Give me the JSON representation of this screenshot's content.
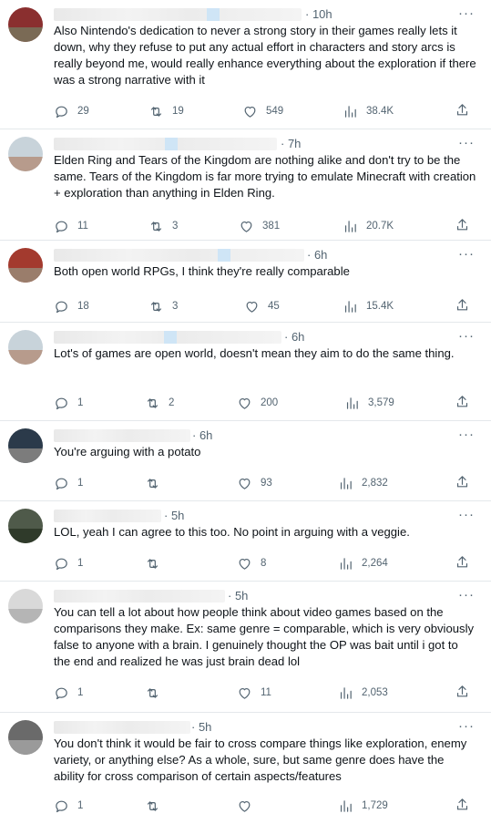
{
  "more_label": "···",
  "tweets": [
    {
      "time": "· 10h",
      "text": "Also Nintendo's dedication to never a strong story in their games really lets it down, why they refuse to put any actual effort in characters and story arcs is really beyond me, would really enhance everything about the exploration if there was a strong narrative with it",
      "replies": "29",
      "reposts": "19",
      "likes": "549",
      "views": "38.4K",
      "avatar_colors": [
        "#8a2f2f",
        "#7a6a55"
      ]
    },
    {
      "time": "· 7h",
      "text": "Elden Ring and Tears of the Kingdom are nothing alike and don't try to be the same. Tears of the Kingdom is far more trying to emulate Minecraft with creation + exploration than anything in Elden Ring.",
      "replies": "11",
      "reposts": "3",
      "likes": "381",
      "views": "20.7K",
      "avatar_colors": [
        "#c8d3da",
        "#b79b8c"
      ]
    },
    {
      "time": "· 6h",
      "text": "Both open world RPGs, I think they're really comparable",
      "replies": "18",
      "reposts": "3",
      "likes": "45",
      "views": "15.4K",
      "avatar_colors": [
        "#a33a2e",
        "#9a7d6b"
      ]
    },
    {
      "time": "· 6h",
      "text": "Lot's of games are open world, doesn't mean they aim to do the same thing.",
      "replies": "1",
      "reposts": "2",
      "likes": "200",
      "views": "3,579",
      "avatar_colors": [
        "#c8d3da",
        "#b79b8c"
      ]
    },
    {
      "time": "· 6h",
      "text": "You're arguing with a potato",
      "replies": "1",
      "reposts": "",
      "likes": "93",
      "views": "2,832",
      "avatar_colors": [
        "#2b3a4a",
        "#7c7c7c"
      ]
    },
    {
      "time": "· 5h",
      "text": "LOL, yeah I can agree to this too. No point in arguing with a veggie.",
      "replies": "1",
      "reposts": "",
      "likes": "8",
      "views": "2,264",
      "avatar_colors": [
        "#4f5a4a",
        "#2f3a2a"
      ]
    },
    {
      "time": "· 5h",
      "text": "You can tell a lot about how people think about video games based on the comparisons they make. Ex: same genre = comparable, which is very obviously false to anyone with a brain. I genuinely thought the OP was bait until i got to the end and realized he was just brain dead lol",
      "replies": "1",
      "reposts": "",
      "likes": "11",
      "views": "2,053",
      "avatar_colors": [
        "#d9d9d9",
        "#b5b5b5"
      ]
    },
    {
      "time": "· 5h",
      "text": "You don't think it would be fair to cross compare things like exploration, enemy variety, or anything else? As a whole, sure, but same genre does have the ability for cross comparison of certain aspects/features",
      "replies": "1",
      "reposts": "",
      "likes": "",
      "views": "1,729",
      "avatar_colors": [
        "#6a6a6a",
        "#9a9a9a"
      ]
    }
  ]
}
